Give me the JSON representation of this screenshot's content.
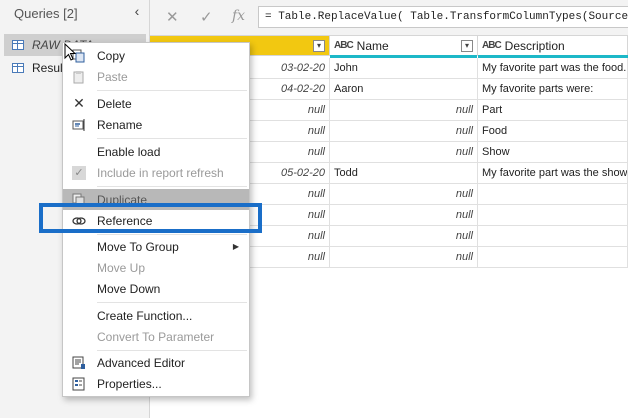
{
  "queries": {
    "header": "Queries [2]",
    "collapse_glyph": "‹",
    "items": [
      {
        "label": "RAW DATA",
        "icon": "table-icon"
      },
      {
        "label": "Result",
        "icon": "table-icon"
      }
    ]
  },
  "formula_bar": {
    "cancel_glyph": "✕",
    "confirm_glyph": "✓",
    "fx_glyph": "fx",
    "formula": "= Table.ReplaceValue( Table.TransformColumnTypes(Source,{{\"D"
  },
  "grid": {
    "columns": [
      {
        "label": "",
        "type": "date"
      },
      {
        "label": "Name",
        "type": "ABC"
      },
      {
        "label": "Description",
        "type": "ABC"
      }
    ],
    "type_glyph": "ABC",
    "rows": [
      {
        "date": "03-02-20",
        "name": "John",
        "desc": "My favorite part was the food."
      },
      {
        "date": "04-02-20",
        "name": "Aaron",
        "desc": "My favorite parts were:"
      },
      {
        "date": "null",
        "name": "null",
        "desc": "Part"
      },
      {
        "date": "null",
        "name": "null",
        "desc": "Food"
      },
      {
        "date": "null",
        "name": "null",
        "desc": "Show"
      },
      {
        "date": "05-02-20",
        "name": "Todd",
        "desc": "My favorite part was the show."
      },
      {
        "date": "null",
        "name": "null",
        "desc": ""
      },
      {
        "date": "null",
        "name": "null",
        "desc": ""
      },
      {
        "date": "null",
        "name": "null",
        "desc": ""
      },
      {
        "date": "null",
        "name": "null",
        "desc": ""
      }
    ]
  },
  "context_menu": {
    "items": [
      {
        "label": "Copy",
        "icon": "copy-icon",
        "disabled": false
      },
      {
        "label": "Paste",
        "icon": "paste-icon",
        "disabled": true
      },
      {
        "label": "Delete",
        "icon": "delete-icon",
        "disabled": false
      },
      {
        "label": "Rename",
        "icon": "rename-icon",
        "disabled": false
      },
      {
        "label": "Enable load",
        "icon": "",
        "disabled": false
      },
      {
        "label": "Include in report refresh",
        "icon": "check-icon",
        "disabled": true
      },
      {
        "label": "Duplicate",
        "icon": "duplicate-icon",
        "disabled": false,
        "highlighted": true
      },
      {
        "label": "Reference",
        "icon": "reference-icon",
        "disabled": false
      },
      {
        "label": "Move To Group",
        "icon": "",
        "disabled": false,
        "submenu": true
      },
      {
        "label": "Move Up",
        "icon": "",
        "disabled": true
      },
      {
        "label": "Move Down",
        "icon": "",
        "disabled": false
      },
      {
        "label": "Create Function...",
        "icon": "",
        "disabled": false
      },
      {
        "label": "Convert To Parameter",
        "icon": "",
        "disabled": true
      },
      {
        "label": "Advanced Editor",
        "icon": "advanced-editor-icon",
        "disabled": false
      },
      {
        "label": "Properties...",
        "icon": "properties-icon",
        "disabled": false
      }
    ]
  },
  "colors": {
    "accent_yellow": "#f2c811",
    "accent_teal": "#1cb8c8",
    "highlight_blue": "#1a6ec8",
    "menu_highlight": "#b8b8b8"
  }
}
